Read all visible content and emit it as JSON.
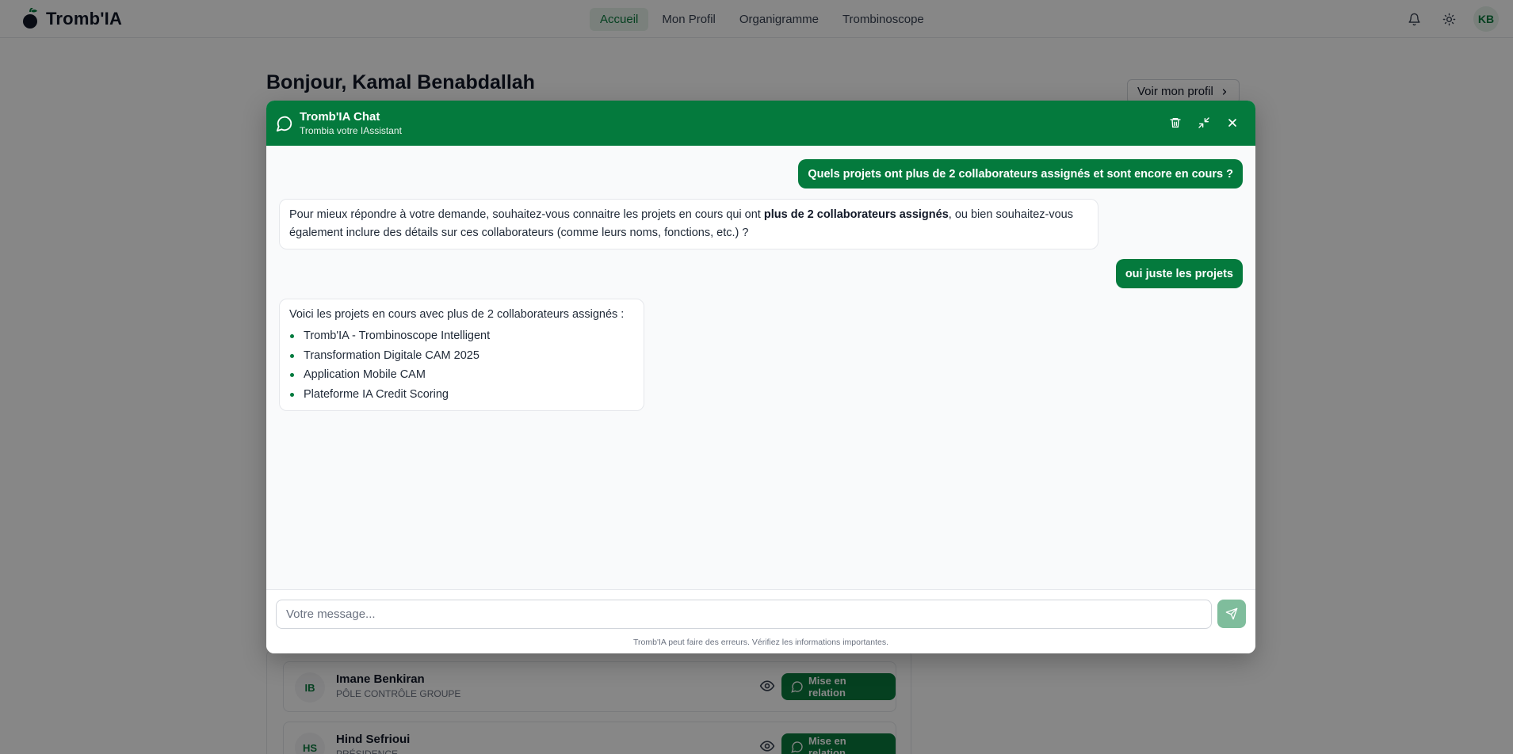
{
  "app": {
    "brand": "Tromb'IA",
    "nav": [
      "Accueil",
      "Mon Profil",
      "Organigramme",
      "Trombinoscope"
    ],
    "active_nav": "Accueil",
    "user_initials": "KB"
  },
  "page": {
    "greeting": "Bonjour, Kamal Benabdallah",
    "profile_button": "Voir mon profil"
  },
  "people": [
    {
      "initials": "IB",
      "name": "Imane Benkiran",
      "role": "PÔLE CONTRÔLE GROUPE",
      "action": "Mise en relation"
    },
    {
      "initials": "HS",
      "name": "Hind Sefrioui",
      "role": "PRÉSIDENCE",
      "action": "Mise en relation"
    }
  ],
  "chat": {
    "title": "Tromb'IA Chat",
    "subtitle": "Trombia votre IAssistant",
    "messages": [
      {
        "role": "user",
        "text": "Quels projets ont plus de 2 collaborateurs assignés et sont encore en cours ?"
      },
      {
        "role": "bot",
        "text_before": "Pour mieux répondre à votre demande, souhaitez-vous connaitre les projets en cours qui ont ",
        "text_bold": "plus de 2 collaborateurs assignés",
        "text_after": ", ou bien souhaitez-vous",
        "text_line2": "également inclure des détails sur ces collaborateurs (comme leurs noms, fonctions, etc.) ?"
      },
      {
        "role": "user",
        "text": "oui juste les projets"
      },
      {
        "role": "bot",
        "intro": "Voici les projets en cours avec plus de 2 collaborateurs assignés :",
        "items": [
          "Tromb'IA - Trombinoscope Intelligent",
          "Transformation Digitale CAM 2025",
          "Application Mobile CAM",
          "Plateforme IA Credit Scoring"
        ]
      }
    ],
    "input_placeholder": "Votre message...",
    "disclaimer": "Tromb'IA peut faire des erreurs. Vérifiez les informations importantes."
  },
  "colors": {
    "primary": "#047a3d",
    "send_disabled": "#7fbd9c",
    "overlay": "rgba(0,0,0,0.47)"
  }
}
